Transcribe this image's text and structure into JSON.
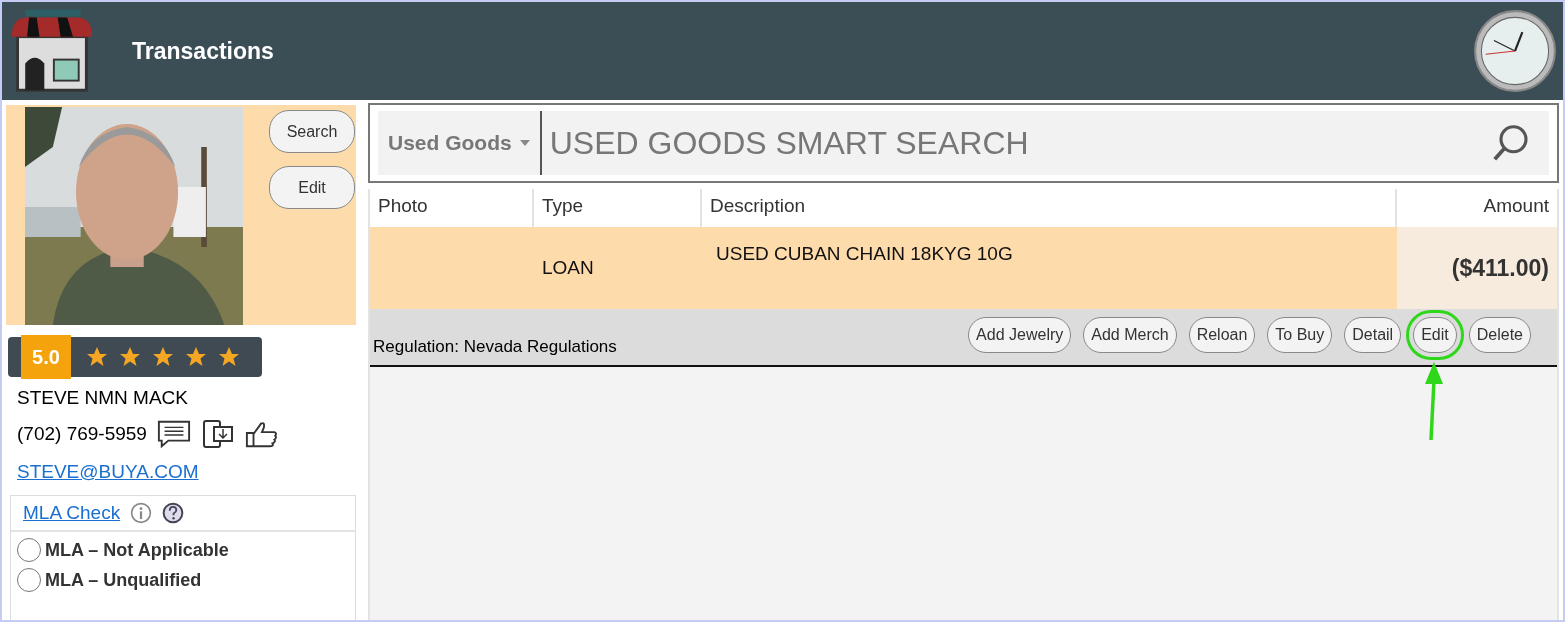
{
  "header": {
    "title": "Transactions"
  },
  "customer": {
    "buttons": [
      "Search",
      "Edit"
    ],
    "rating": {
      "score": "5.0",
      "stars": 5
    },
    "name": "STEVE NMN MACK",
    "phone": "(702) 769-5959",
    "email": "STEVE@BUYA.COM",
    "mla": {
      "title": "MLA Check",
      "options": [
        {
          "label": "MLA – Not Applicable",
          "selected": false
        },
        {
          "label": "MLA – Unqualified",
          "selected": false
        }
      ]
    }
  },
  "search": {
    "category": "Used Goods",
    "placeholder": "USED GOODS SMART SEARCH"
  },
  "table": {
    "columns": [
      "Photo",
      "Type",
      "Description",
      "Amount"
    ],
    "rows": [
      {
        "type": "LOAN",
        "description": "USED CUBAN CHAIN 18KYG 10G",
        "amount": "($411.00)",
        "selected": true
      }
    ]
  },
  "regulation": "Regulation: Nevada Regulations",
  "actions": [
    {
      "label": "Add Jewelry",
      "highlighted": false
    },
    {
      "label": "Add Merch",
      "highlighted": false
    },
    {
      "label": "Reloan",
      "highlighted": false
    },
    {
      "label": "To Buy",
      "highlighted": false
    },
    {
      "label": "Detail",
      "highlighted": false
    },
    {
      "label": "Edit",
      "highlighted": true
    },
    {
      "label": "Delete",
      "highlighted": false
    }
  ]
}
